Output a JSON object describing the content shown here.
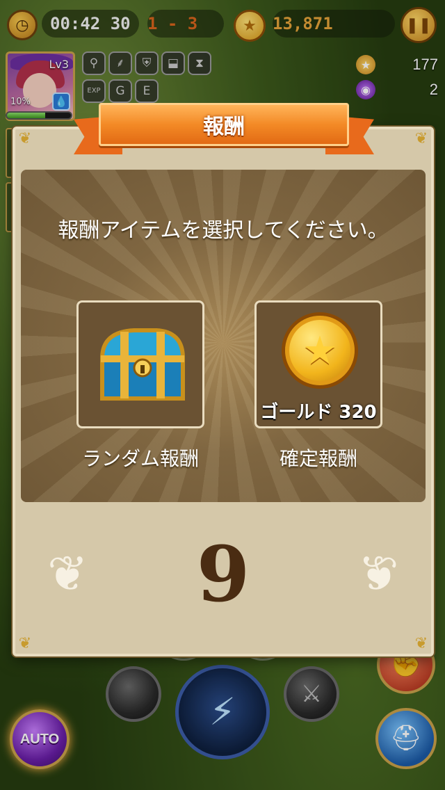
{
  "hud": {
    "timer": "00:42 30",
    "stage": "1 - 3",
    "gold_total": "13,871"
  },
  "hero": {
    "level": "Lv3",
    "exp_percent_label": "10%",
    "hp_fraction": 0.6
  },
  "skill_badges": [
    "EXP",
    "G",
    "E"
  ],
  "resources": {
    "coins": "177",
    "gems": "2"
  },
  "dialog": {
    "title": "報酬",
    "prompt": "報酬アイテムを選択してください。",
    "options": [
      {
        "label": "ランダム報酬"
      },
      {
        "label": "確定報酬",
        "reward_text": "ゴールド 320"
      }
    ],
    "countdown": "9"
  },
  "controls": {
    "auto_label": "AUTO"
  },
  "colors": {
    "banner": "#f38a26",
    "dialog_bg": "#d5c8a9",
    "countdown": "#4a2c12",
    "stage_text": "#d8641d",
    "gold_text": "#e6a43a"
  },
  "icons": [
    "clock-icon",
    "coin-icon",
    "pause-icon",
    "water-element-icon",
    "treasure-chest-icon",
    "gold-coin-icon",
    "wing-icon",
    "sword-icon",
    "lightning-icon",
    "fist-icon",
    "swap-helmet-icon",
    "gem-icon"
  ]
}
